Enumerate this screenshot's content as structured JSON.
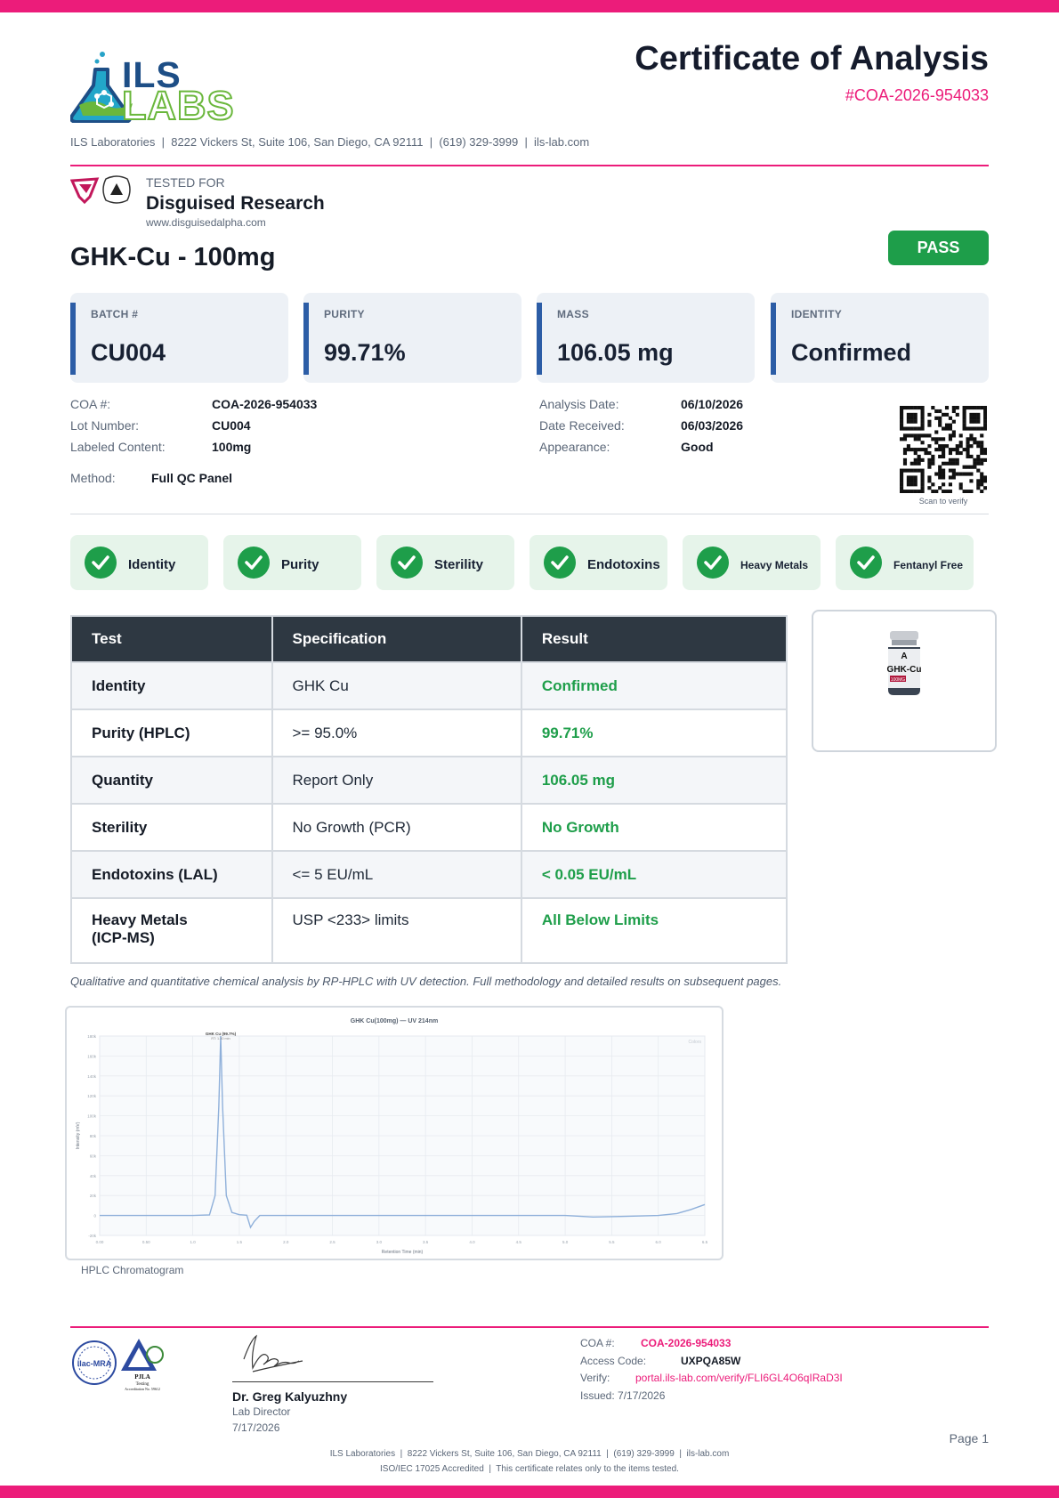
{
  "header": {
    "logo_top": "ILS",
    "logo_bottom": "LABS",
    "title": "Certificate of Analysis",
    "coa_ref": "#COA-2026-954033",
    "address": "ILS Laboratories  |  8222 Vickers St, Suite 106, San Diego, CA 92111  |  (619) 329-3999  |  ils-lab.com"
  },
  "client": {
    "tested_for": "TESTED FOR",
    "name": "Disguised Research",
    "url": "www.disguisedalpha.com"
  },
  "product": {
    "name": "GHK-Cu - 100mg",
    "status": "PASS"
  },
  "summary_cards": [
    {
      "label": "BATCH #",
      "value": "CU004"
    },
    {
      "label": "PURITY",
      "value": "99.71%"
    },
    {
      "label": "MASS",
      "value": "106.05 mg"
    },
    {
      "label": "IDENTITY",
      "value": "Confirmed"
    }
  ],
  "details_left": [
    {
      "label": "COA #:",
      "value": "COA-2026-954033"
    },
    {
      "label": "Lot Number:",
      "value": "CU004"
    },
    {
      "label": "Labeled Content:",
      "value": "100mg"
    }
  ],
  "method": {
    "label": "Method:",
    "value": "Full QC Panel"
  },
  "details_right": [
    {
      "label": "Analysis Date:",
      "value": "06/10/2026"
    },
    {
      "label": "Date Received:",
      "value": "06/03/2026"
    },
    {
      "label": "Appearance:",
      "value": "Good"
    }
  ],
  "qr_caption": "Scan to verify",
  "checks": [
    "Identity",
    "Purity",
    "Sterility",
    "Endotoxins",
    "Heavy Metals",
    "Fentanyl Free"
  ],
  "results_table": {
    "headers": [
      "Test",
      "Specification",
      "Result"
    ],
    "rows": [
      {
        "test": "Identity",
        "spec": "GHK Cu",
        "result": "Confirmed"
      },
      {
        "test": "Purity (HPLC)",
        "spec": ">= 95.0%",
        "result": "99.71%"
      },
      {
        "test": "Quantity",
        "spec": "Report Only",
        "result": "106.05 mg"
      },
      {
        "test": "Sterility",
        "spec": "No Growth (PCR)",
        "result": "No Growth"
      },
      {
        "test": "Endotoxins (LAL)",
        "spec": "<= 5 EU/mL",
        "result": "< 0.05 EU/mL"
      },
      {
        "test": "Heavy Metals\n(ICP-MS)",
        "spec": "USP <233> limits",
        "result": "All Below Limits"
      }
    ]
  },
  "vial": {
    "brand": "A",
    "label": "GHK-Cu",
    "dose": "100MG"
  },
  "method_note": "Qualitative and quantitative chemical analysis by RP-HPLC with UV detection. Full methodology and detailed results on subsequent pages.",
  "chart_caption": "HPLC Chromatogram",
  "chart_data": {
    "type": "line",
    "title": "GHK Cu(100mg) — UV 214nm",
    "xlabel": "Retention Time (min)",
    "ylabel": "Intensity (mV)",
    "peak_label": "GHK Cu (99.7%)",
    "peak_sublabel": "RT: 1.30 min",
    "legend": "Colors",
    "xlim": [
      0,
      6.5
    ],
    "ylim": [
      -20000,
      180000
    ],
    "x_ticks": [
      "0.00",
      "0.50",
      "1.0",
      "1.5",
      "2.0",
      "2.5",
      "3.0",
      "3.5",
      "4.0",
      "4.5",
      "5.0",
      "5.5",
      "6.0",
      "6.5"
    ],
    "y_ticks": [
      "-20k",
      "0",
      "20k",
      "40k",
      "60k",
      "80k",
      "100k",
      "120k",
      "140k",
      "160k",
      "180k"
    ],
    "series": [
      {
        "x": [
          0,
          0.5,
          1.0,
          1.18,
          1.24,
          1.28,
          1.3,
          1.32,
          1.36,
          1.42,
          1.5,
          1.58,
          1.62,
          1.66,
          1.72,
          1.8,
          2.0,
          3.0,
          4.0,
          5.0,
          5.3,
          5.6,
          6.0,
          6.2,
          6.35,
          6.5
        ],
        "y": [
          0,
          0,
          0,
          500,
          20000,
          110000,
          180000,
          110000,
          20000,
          3000,
          800,
          300,
          -12000,
          -6000,
          0,
          0,
          0,
          0,
          0,
          0,
          -1500,
          -1000,
          0,
          2000,
          6000,
          11000
        ]
      }
    ]
  },
  "signature": {
    "name": "Dr. Greg Kalyuzhny",
    "role": "Lab Director",
    "date": "7/17/2026"
  },
  "accreditation": {
    "ilac": "ilac-MRA",
    "pjla": "PJLA",
    "pjla_sub": "Testing",
    "pjla_acc": "Accreditation No. 59612"
  },
  "verification": {
    "coa_label": "COA #:",
    "coa_value": "COA-2026-954033",
    "access_label": "Access Code:",
    "access_value": "UXPQA85W",
    "verify_label": "Verify:",
    "verify_value": "portal.ils-lab.com/verify/FLI6GL4O6qIRaD3I",
    "issued": "Issued: 7/17/2026"
  },
  "page": "Page 1",
  "footer": {
    "line1": "ILS Laboratories  |  8222 Vickers St, Suite 106, San Diego, CA 92111  |  (619) 329-3999  |  ils-lab.com",
    "line2": "ISO/IEC 17025 Accredited  |  This certificate relates only to the items tested."
  },
  "colors": {
    "brand_pink": "#ec1c7a",
    "pass_green": "#1e9e4a",
    "card_accent": "#2c5da6",
    "table_header": "#2e3842"
  }
}
